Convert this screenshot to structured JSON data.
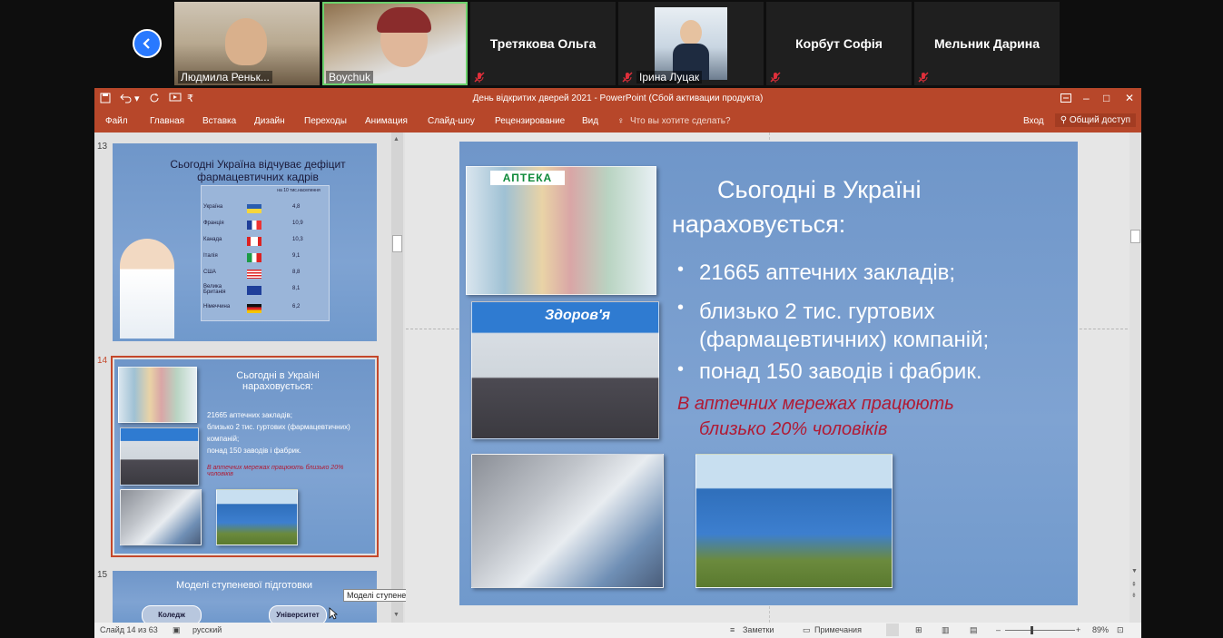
{
  "zoom": {
    "participants": [
      {
        "name": "Людмила Реньк...",
        "video": true
      },
      {
        "name": "Boychuk",
        "video": true
      },
      {
        "name": "Третякова Ольга",
        "video": false
      },
      {
        "name": "Ірина Луцак",
        "video": true
      },
      {
        "name": "Корбут Софія",
        "video": false
      },
      {
        "name": "Мельник Дарина",
        "video": false
      }
    ]
  },
  "ppt": {
    "window_title": "День відкритих дверей 2021 - PowerPoint (Сбой активации продукта)",
    "menu": [
      "Файл",
      "Главная",
      "Вставка",
      "Дизайн",
      "Переходы",
      "Анимация",
      "Слайд-шоу",
      "Рецензирование",
      "Вид"
    ],
    "tell_me": "Что вы хотите сделать?",
    "sign_in": "Вход",
    "share": "Общий доступ",
    "thumbnails": {
      "s13": {
        "number": "13",
        "title": "Сьогодні Україна відчуває дефіцит фармацевтичних кадрів",
        "table_header": "на 10 тис.населення",
        "rows": [
          {
            "country": "Україна",
            "value": "4,8"
          },
          {
            "country": "Франція",
            "value": "10,9"
          },
          {
            "country": "Канада",
            "value": "10,3"
          },
          {
            "country": "Італія",
            "value": "9,1"
          },
          {
            "country": "США",
            "value": "8,8"
          },
          {
            "country": "Велика Британія",
            "value": "8,1"
          },
          {
            "country": "Німеччина",
            "value": "6,2"
          }
        ]
      },
      "s14": {
        "number": "14",
        "title": "Сьогодні в Україні нараховується:",
        "bullets": [
          "21665 аптечних закладів;",
          "близько 2 тис. гуртових (фармацевтичних) компаній;",
          "понад 150 заводів і фабрик."
        ],
        "note": "В аптечних мережах працюють близько 20% чоловіків"
      },
      "s15": {
        "number": "15",
        "title": "Моделі ступеневої підготовки",
        "btn1": "Коледж",
        "btn2": "Університет"
      }
    },
    "tooltip": "Моделі ступеневої підготовки",
    "slide": {
      "title": "Сьогодні в Україні нараховується:",
      "bullets": [
        "21665 аптечних закладів;",
        "близько 2 тис. гуртових (фармацевтичних) компаній;",
        "понад 150 заводів і фабрик."
      ],
      "note_line1": "В аптечних мережах працюють",
      "note_line2": "близько 20% чоловіків",
      "pharmacy_sign": "АПТЕКА",
      "company_sign": "Здоров'я"
    },
    "status": {
      "slide_info": "Слайд 14 из 63",
      "language": "русский",
      "notes": "Заметки",
      "comments": "Примечания",
      "zoom": "89%"
    },
    "colors": {
      "ribbon": "#b7472a",
      "accent_note": "#b01b35",
      "zoom_back": "#2979ff"
    }
  }
}
